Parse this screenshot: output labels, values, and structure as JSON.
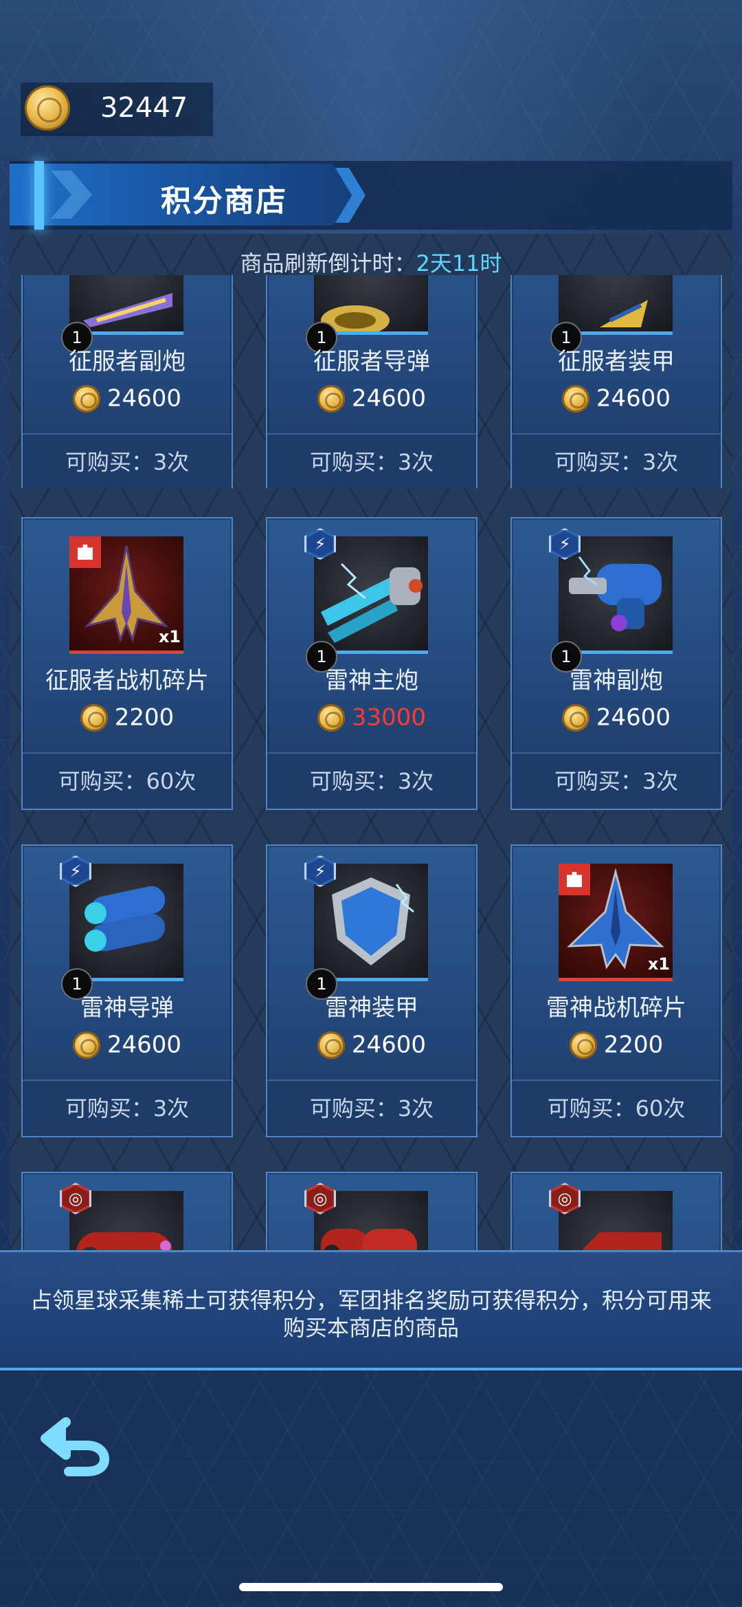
{
  "header": {
    "balance": "32447",
    "title": "积分商店",
    "refresh_label": "商品刷新倒计时：",
    "refresh_time": "2天11时"
  },
  "items": [
    {
      "name": "征服者副炮",
      "price": "24600",
      "limit": "可购买：3次",
      "count": "1",
      "icon": "conqueror-secondary-cannon-icon"
    },
    {
      "name": "征服者导弹",
      "price": "24600",
      "limit": "可购买：3次",
      "count": "1",
      "icon": "conqueror-missile-icon"
    },
    {
      "name": "征服者装甲",
      "price": "24600",
      "limit": "可购买：3次",
      "count": "1",
      "icon": "conqueror-armor-icon"
    },
    {
      "name": "征服者战机碎片",
      "price": "2200",
      "limit": "可购买：60次",
      "qty": "x1",
      "icon": "conqueror-fighter-fragment-icon"
    },
    {
      "name": "雷神主炮",
      "price": "33000",
      "price_color": "#ff3b2f",
      "limit": "可购买：3次",
      "count": "1",
      "icon": "thor-main-cannon-icon"
    },
    {
      "name": "雷神副炮",
      "price": "24600",
      "limit": "可购买：3次",
      "count": "1",
      "icon": "thor-secondary-cannon-icon"
    },
    {
      "name": "雷神导弹",
      "price": "24600",
      "limit": "可购买：3次",
      "count": "1",
      "icon": "thor-missile-icon"
    },
    {
      "name": "雷神装甲",
      "price": "24600",
      "limit": "可购买：3次",
      "count": "1",
      "icon": "thor-armor-icon"
    },
    {
      "name": "雷神战机碎片",
      "price": "2200",
      "limit": "可购买：60次",
      "qty": "x1",
      "icon": "thor-fighter-fragment-icon"
    }
  ],
  "info": {
    "text": "占领星球采集稀土可获得积分，军团排名奖励可获得积分，积分可用来购买本商店的商品"
  },
  "colors": {
    "accent": "#5bc4ff",
    "price_warning": "#ff3b2f",
    "card_bg": "#2d5a93"
  }
}
